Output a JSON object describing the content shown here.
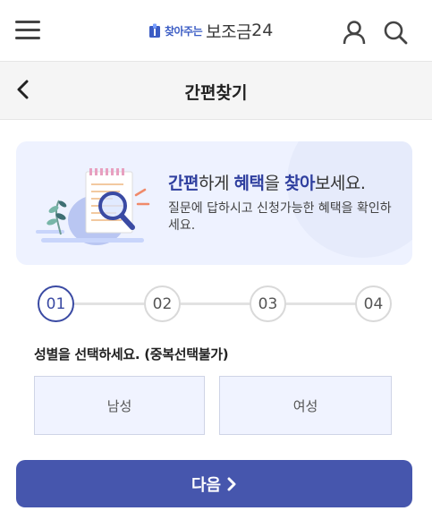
{
  "header": {
    "logo_sub": "찾아주는",
    "logo_main": "보조금",
    "logo_num": "24",
    "menu_icon": "hamburger-icon",
    "user_icon": "user-icon",
    "search_icon": "search-icon"
  },
  "subheader": {
    "title": "간편찾기",
    "back_icon": "chevron-left-icon"
  },
  "banner": {
    "headline": [
      {
        "text": "간편",
        "bold": true
      },
      {
        "text": "하게 ",
        "bold": false
      },
      {
        "text": "혜택",
        "bold": true
      },
      {
        "text": "을 ",
        "bold": false
      },
      {
        "text": "찾아",
        "bold": true
      },
      {
        "text": "보세요.",
        "bold": false
      }
    ],
    "description": "질문에 답하시고 신청가능한 혜택을 확인하세요."
  },
  "steps": {
    "items": [
      "01",
      "02",
      "03",
      "04"
    ],
    "current": "01"
  },
  "question": {
    "text": "성별을 선택하세요. (중복선택불가)",
    "options": [
      "남성",
      "여성"
    ]
  },
  "next_button": {
    "label": "다음",
    "icon": "chevron-right-icon"
  },
  "colors": {
    "primary": "#4656ad",
    "accent": "#2f3f9f",
    "banner_bg": "#eef2ff",
    "option_bg": "#f0f3ff"
  }
}
